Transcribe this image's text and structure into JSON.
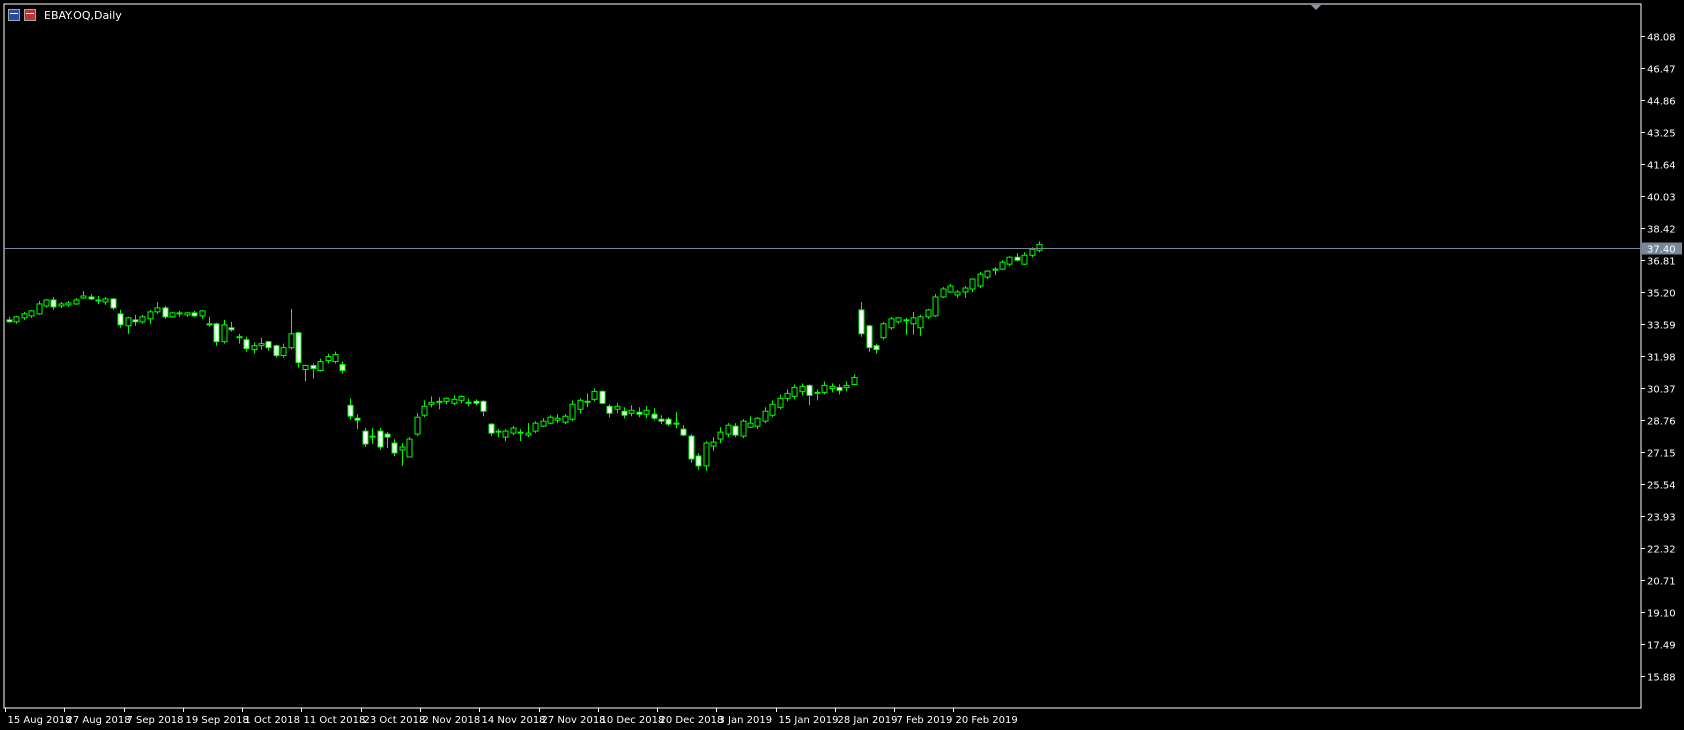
{
  "window": {
    "title": "EBAY.OQ,Daily",
    "icons": [
      "chart-window-icon",
      "chart-window-icon-2"
    ]
  },
  "colors": {
    "background": "#000000",
    "frame": "#ffffff",
    "candle_bull_body": "#000000",
    "candle_bear_body": "#ffffff",
    "wick": "#00ff00",
    "price_line": "#778899",
    "price_label_bg": "#778899",
    "axis_text": "#ffffff"
  },
  "chart_data": {
    "type": "candlestick",
    "symbol": "EBAY.OQ",
    "timeframe": "Daily",
    "title": "EBAY.OQ,Daily",
    "xlabel": "",
    "ylabel": "",
    "ylim": [
      14.27,
      49.69
    ],
    "grid": false,
    "legend": "none",
    "current_price": 37.4,
    "current_price_label": "37.40",
    "y_ticks": [
      "48.08",
      "46.47",
      "44.86",
      "43.25",
      "41.64",
      "40.03",
      "38.42",
      "36.81",
      "35.20",
      "33.59",
      "31.98",
      "30.37",
      "28.76",
      "27.15",
      "25.54",
      "23.93",
      "22.32",
      "20.71",
      "19.10",
      "17.49",
      "15.88"
    ],
    "x_ticks": [
      {
        "label": "15 Aug 2018",
        "index": 0
      },
      {
        "label": "27 Aug 2018",
        "index": 8
      },
      {
        "label": "7 Sep 2018",
        "index": 16
      },
      {
        "label": "19 Sep 2018",
        "index": 24
      },
      {
        "label": "1 Oct 2018",
        "index": 32
      },
      {
        "label": "11 Oct 2018",
        "index": 40
      },
      {
        "label": "23 Oct 2018",
        "index": 48
      },
      {
        "label": "2 Nov 2018",
        "index": 56
      },
      {
        "label": "14 Nov 2018",
        "index": 64
      },
      {
        "label": "27 Nov 2018",
        "index": 72
      },
      {
        "label": "10 Dec 2018",
        "index": 80
      },
      {
        "label": "20 Dec 2018",
        "index": 88
      },
      {
        "label": "3 Jan 2019",
        "index": 96
      },
      {
        "label": "15 Jan 2019",
        "index": 104
      },
      {
        "label": "28 Jan 2019",
        "index": 112
      },
      {
        "label": "7 Feb 2019",
        "index": 120
      },
      {
        "label": "20 Feb 2019",
        "index": 128
      }
    ],
    "candles": [
      [
        33.8,
        33.95,
        33.65,
        33.7
      ],
      [
        33.7,
        34.0,
        33.6,
        33.95
      ],
      [
        33.9,
        34.2,
        33.8,
        34.1
      ],
      [
        34.0,
        34.3,
        33.9,
        34.25
      ],
      [
        34.1,
        34.75,
        34.05,
        34.6
      ],
      [
        34.5,
        34.85,
        34.4,
        34.8
      ],
      [
        34.8,
        34.95,
        34.3,
        34.45
      ],
      [
        34.5,
        34.7,
        34.4,
        34.6
      ],
      [
        34.55,
        34.75,
        34.45,
        34.65
      ],
      [
        34.6,
        34.9,
        34.55,
        34.8
      ],
      [
        34.9,
        35.25,
        34.85,
        35.0
      ],
      [
        34.95,
        35.1,
        34.8,
        34.85
      ],
      [
        34.8,
        35.0,
        34.6,
        34.75
      ],
      [
        34.7,
        34.95,
        34.55,
        34.85
      ],
      [
        34.85,
        34.9,
        34.3,
        34.4
      ],
      [
        34.1,
        34.3,
        33.4,
        33.55
      ],
      [
        33.5,
        33.95,
        33.1,
        33.9
      ],
      [
        33.8,
        34.05,
        33.5,
        33.7
      ],
      [
        33.7,
        34.05,
        33.6,
        33.95
      ],
      [
        33.85,
        34.3,
        33.6,
        34.2
      ],
      [
        34.2,
        34.7,
        34.1,
        34.4
      ],
      [
        34.4,
        34.5,
        33.85,
        33.95
      ],
      [
        33.95,
        34.2,
        33.9,
        34.15
      ],
      [
        34.15,
        34.25,
        33.95,
        34.1
      ],
      [
        34.05,
        34.2,
        33.95,
        34.15
      ],
      [
        34.15,
        34.25,
        33.95,
        34.0
      ],
      [
        34.0,
        34.3,
        33.85,
        34.25
      ],
      [
        33.6,
        33.95,
        33.45,
        33.55
      ],
      [
        33.6,
        33.65,
        32.5,
        32.7
      ],
      [
        32.7,
        33.8,
        32.6,
        33.55
      ],
      [
        33.4,
        33.7,
        33.2,
        33.3
      ],
      [
        32.95,
        33.1,
        32.6,
        32.9
      ],
      [
        32.8,
        32.95,
        32.2,
        32.35
      ],
      [
        32.3,
        32.65,
        32.1,
        32.5
      ],
      [
        32.5,
        32.9,
        32.3,
        32.6
      ],
      [
        32.7,
        32.75,
        32.25,
        32.4
      ],
      [
        32.5,
        32.55,
        31.9,
        32.0
      ],
      [
        32.0,
        32.6,
        31.9,
        32.4
      ],
      [
        32.4,
        34.35,
        32.3,
        33.1
      ],
      [
        33.15,
        33.2,
        31.4,
        31.65
      ],
      [
        31.3,
        31.55,
        30.7,
        31.5
      ],
      [
        31.5,
        31.6,
        30.85,
        31.35
      ],
      [
        31.25,
        31.85,
        31.2,
        31.7
      ],
      [
        31.75,
        32.1,
        31.6,
        31.95
      ],
      [
        31.7,
        32.2,
        31.6,
        32.05
      ],
      [
        31.55,
        31.7,
        31.1,
        31.25
      ],
      [
        29.5,
        29.85,
        28.8,
        28.95
      ],
      [
        28.85,
        29.05,
        28.3,
        28.75
      ],
      [
        28.2,
        28.35,
        27.4,
        27.55
      ],
      [
        27.95,
        28.35,
        27.55,
        27.9
      ],
      [
        28.2,
        28.35,
        27.25,
        27.4
      ],
      [
        28.05,
        28.15,
        27.35,
        27.9
      ],
      [
        27.6,
        27.8,
        26.95,
        27.1
      ],
      [
        27.25,
        27.6,
        26.45,
        27.4
      ],
      [
        26.9,
        27.9,
        26.9,
        27.8
      ],
      [
        28.05,
        29.1,
        27.95,
        28.9
      ],
      [
        29.0,
        29.75,
        28.9,
        29.45
      ],
      [
        29.55,
        29.95,
        29.4,
        29.65
      ],
      [
        29.7,
        29.9,
        29.3,
        29.7
      ],
      [
        29.7,
        29.9,
        29.55,
        29.85
      ],
      [
        29.6,
        30.0,
        29.5,
        29.8
      ],
      [
        29.75,
        30.0,
        29.6,
        29.95
      ],
      [
        29.65,
        29.85,
        29.45,
        29.65
      ],
      [
        29.7,
        29.8,
        29.5,
        29.6
      ],
      [
        29.7,
        29.75,
        28.95,
        29.2
      ],
      [
        28.55,
        28.6,
        27.95,
        28.1
      ],
      [
        28.2,
        28.3,
        27.9,
        28.15
      ],
      [
        27.9,
        28.3,
        27.7,
        28.2
      ],
      [
        28.1,
        28.45,
        28.0,
        28.35
      ],
      [
        28.1,
        28.3,
        27.7,
        28.15
      ],
      [
        28.0,
        28.6,
        27.9,
        28.1
      ],
      [
        28.2,
        28.7,
        28.1,
        28.6
      ],
      [
        28.45,
        28.85,
        28.4,
        28.7
      ],
      [
        28.6,
        29.0,
        28.55,
        28.9
      ],
      [
        28.75,
        29.05,
        28.6,
        28.85
      ],
      [
        28.65,
        29.05,
        28.55,
        28.95
      ],
      [
        28.8,
        29.75,
        28.7,
        29.55
      ],
      [
        29.3,
        29.85,
        29.1,
        29.75
      ],
      [
        29.7,
        30.1,
        29.4,
        29.65
      ],
      [
        29.8,
        30.35,
        29.7,
        30.2
      ],
      [
        30.2,
        30.25,
        29.55,
        29.6
      ],
      [
        29.45,
        29.55,
        28.9,
        29.1
      ],
      [
        29.3,
        29.6,
        29.1,
        29.45
      ],
      [
        29.2,
        29.4,
        28.85,
        29.0
      ],
      [
        29.1,
        29.5,
        28.95,
        29.25
      ],
      [
        29.15,
        29.4,
        28.9,
        29.05
      ],
      [
        29.05,
        29.45,
        28.85,
        29.25
      ],
      [
        29.05,
        29.35,
        28.75,
        28.85
      ],
      [
        28.8,
        29.0,
        28.55,
        28.7
      ],
      [
        28.8,
        28.9,
        28.45,
        28.55
      ],
      [
        28.6,
        29.15,
        28.35,
        28.55
      ],
      [
        28.3,
        28.5,
        27.95,
        28.0
      ],
      [
        27.95,
        28.05,
        26.6,
        26.8
      ],
      [
        26.95,
        27.1,
        26.25,
        26.45
      ],
      [
        26.45,
        27.7,
        26.2,
        27.6
      ],
      [
        27.45,
        27.9,
        27.2,
        27.65
      ],
      [
        27.8,
        28.4,
        27.6,
        28.15
      ],
      [
        28.05,
        28.6,
        27.9,
        28.5
      ],
      [
        28.45,
        28.6,
        27.9,
        28.0
      ],
      [
        27.95,
        28.8,
        27.85,
        28.7
      ],
      [
        28.4,
        28.95,
        28.35,
        28.6
      ],
      [
        28.45,
        28.9,
        28.3,
        28.85
      ],
      [
        28.7,
        29.4,
        28.6,
        29.2
      ],
      [
        29.0,
        29.75,
        28.9,
        29.55
      ],
      [
        29.4,
        30.05,
        29.3,
        29.85
      ],
      [
        29.85,
        30.3,
        29.7,
        30.1
      ],
      [
        29.95,
        30.55,
        29.8,
        30.4
      ],
      [
        30.2,
        30.6,
        30.0,
        30.45
      ],
      [
        30.5,
        30.55,
        29.5,
        30.0
      ],
      [
        30.1,
        30.3,
        29.75,
        30.15
      ],
      [
        30.15,
        30.7,
        30.05,
        30.5
      ],
      [
        30.35,
        30.6,
        30.15,
        30.45
      ],
      [
        30.4,
        30.55,
        30.05,
        30.25
      ],
      [
        30.4,
        30.7,
        30.2,
        30.5
      ],
      [
        30.55,
        31.05,
        30.5,
        30.9
      ],
      [
        34.3,
        34.7,
        32.95,
        33.1
      ],
      [
        33.5,
        33.55,
        32.2,
        32.4
      ],
      [
        32.5,
        32.6,
        32.1,
        32.3
      ],
      [
        32.9,
        33.7,
        32.8,
        33.6
      ],
      [
        33.4,
        33.95,
        33.3,
        33.85
      ],
      [
        33.7,
        33.95,
        33.6,
        33.9
      ],
      [
        33.8,
        33.9,
        33.05,
        33.8
      ],
      [
        33.6,
        34.2,
        33.05,
        33.9
      ],
      [
        33.4,
        34.05,
        33.0,
        33.95
      ],
      [
        33.95,
        34.35,
        33.85,
        34.3
      ],
      [
        34.0,
        35.1,
        33.95,
        34.95
      ],
      [
        34.95,
        35.45,
        34.9,
        35.35
      ],
      [
        35.2,
        35.6,
        35.15,
        35.5
      ],
      [
        35.05,
        35.3,
        34.9,
        35.2
      ],
      [
        35.2,
        35.5,
        34.9,
        35.4
      ],
      [
        35.35,
        35.9,
        35.2,
        35.85
      ],
      [
        35.5,
        36.2,
        35.4,
        36.1
      ],
      [
        35.95,
        36.3,
        35.85,
        36.25
      ],
      [
        36.3,
        36.45,
        36.05,
        36.35
      ],
      [
        36.35,
        36.8,
        36.3,
        36.7
      ],
      [
        36.6,
        37.0,
        36.5,
        36.95
      ],
      [
        36.95,
        37.15,
        36.75,
        36.8
      ],
      [
        36.6,
        37.2,
        36.55,
        37.05
      ],
      [
        37.05,
        37.45,
        36.95,
        37.35
      ],
      [
        37.3,
        37.75,
        37.2,
        37.6
      ]
    ]
  }
}
